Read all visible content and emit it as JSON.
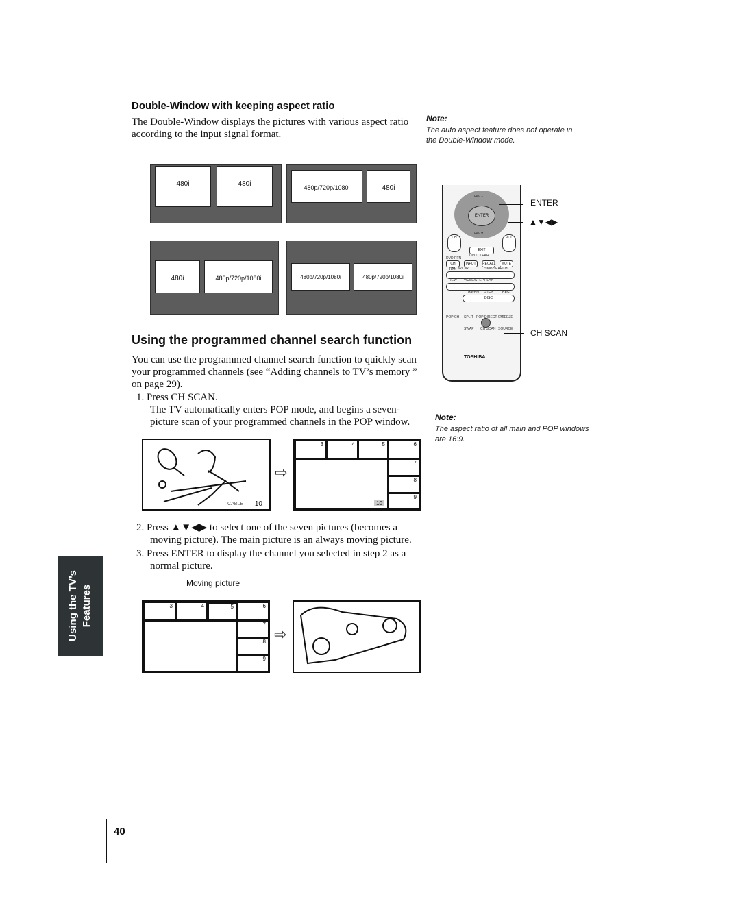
{
  "section1": {
    "heading": "Double-Window with keeping aspect ratio",
    "body_line1": "The Double-Window displays the pictures with various aspect ratio",
    "body_line2": "according to the input signal format."
  },
  "diagrams": {
    "p1": [
      "480i",
      "480i"
    ],
    "p2": [
      "480p/720p/1080i",
      "480i"
    ],
    "p3": [
      "480i",
      "480p/720p/1080i"
    ],
    "p4": [
      "480p/720p/1080i",
      "480p/720p/1080i"
    ]
  },
  "note1": {
    "title": "Note:",
    "line1": "The auto aspect feature does not operate in",
    "line2": "the Double-Window mode."
  },
  "section2": {
    "heading": "Using the programmed channel search function",
    "body_line1": "You can use the programmed channel search function to quickly scan",
    "body_line2": "your programmed channels (see “Adding channels to TV’s memory ”",
    "body_line3": "on page 29)."
  },
  "steps": [
    {
      "num": "1.",
      "line1": "Press CH SCAN.",
      "line2": "The TV automatically enters POP mode, and begins a seven-",
      "line3": "picture scan of your programmed channels in the POP window."
    },
    {
      "num": "2.",
      "line1": "Press ▲▼◀▶ to select one of the seven pictures (becomes a",
      "line2": "moving picture). The main picture is an always moving picture."
    },
    {
      "num": "3.",
      "line1": "Press ENTER to display the channel you selected in step 2 as a",
      "line2": "normal picture."
    }
  ],
  "figure1": {
    "cable_label": "CABLE",
    "channel": "10",
    "pop_channel": "10",
    "thumbs": [
      "3",
      "4",
      "5",
      "6",
      "7",
      "8",
      "9"
    ]
  },
  "figure2": {
    "caption": "Moving picture",
    "thumbs": [
      "3",
      "4",
      "5",
      "6",
      "7",
      "8",
      "9"
    ]
  },
  "remote": {
    "callout_enter": "ENTER",
    "callout_arrows": "▲▼◀▶",
    "callout_chscan": "CH SCAN",
    "brand": "TOSHIBA",
    "enter": "ENTER",
    "exit": "EXIT",
    "fav_up": "FAV▲",
    "fav_down": "FAV▼",
    "ch": "CH",
    "vol": "VOL",
    "buttons": [
      "CH RTN",
      "INPUT",
      "RECALL",
      "MUTE"
    ],
    "labels": [
      "SLOW/DIR",
      "SKIP/SEARCH",
      "REW",
      "PAUSE/STEP",
      "PLAY",
      "FF",
      "AM/PM",
      "STOP",
      "REC",
      "POP CH",
      "SPLIT",
      "POP DIRECT CH",
      "FREEZE",
      "SWAP",
      "CH SCAN",
      "SOURCE",
      "DISC",
      "DVD CLEAR",
      "DVD RTN"
    ]
  },
  "note2": {
    "title": "Note:",
    "line1": "The aspect ratio of all main and POP windows",
    "line2": "are 16:9."
  },
  "side_tab": {
    "line1": "Using the TV’s",
    "line2": "Features"
  },
  "page_number": "40"
}
